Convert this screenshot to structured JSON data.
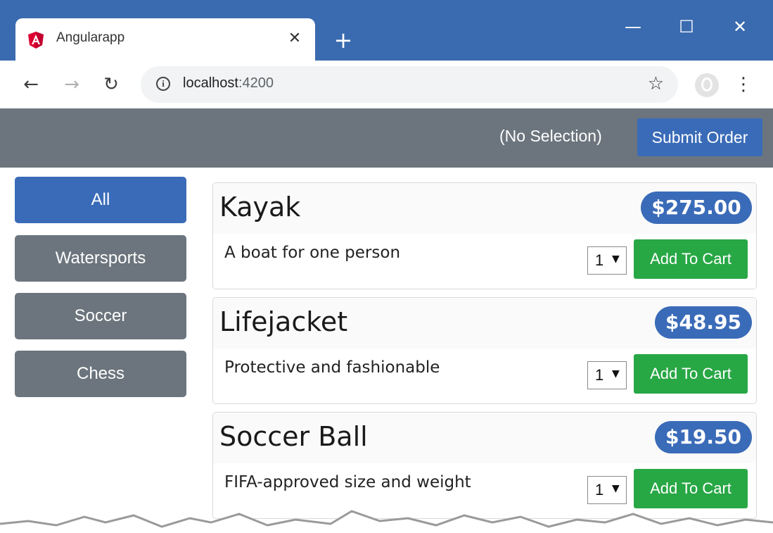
{
  "browser": {
    "tab_title": "Angularapp",
    "tab_close": "✕",
    "new_tab": "+",
    "url_host": "localhost",
    "url_port": ":4200",
    "window_controls": {
      "minimize": "—",
      "maximize": "☐",
      "close": "✕"
    }
  },
  "header": {
    "selection_status": "(No Selection)",
    "submit_label": "Submit Order"
  },
  "categories": [
    {
      "label": "All",
      "active": true
    },
    {
      "label": "Watersports",
      "active": false
    },
    {
      "label": "Soccer",
      "active": false
    },
    {
      "label": "Chess",
      "active": false
    }
  ],
  "products": [
    {
      "name": "Kayak",
      "price": "$275.00",
      "description": "A boat for one person",
      "quantity": "1",
      "add_label": "Add To Cart"
    },
    {
      "name": "Lifejacket",
      "price": "$48.95",
      "description": "Protective and fashionable",
      "quantity": "1",
      "add_label": "Add To Cart"
    },
    {
      "name": "Soccer Ball",
      "price": "$19.50",
      "description": "FIFA-approved size and weight",
      "quantity": "1",
      "add_label": "Add To Cart"
    }
  ],
  "colors": {
    "chrome_blue": "#3a6bb0",
    "primary": "#3a6bb8",
    "secondary": "#6c757d",
    "success": "#28a745"
  }
}
